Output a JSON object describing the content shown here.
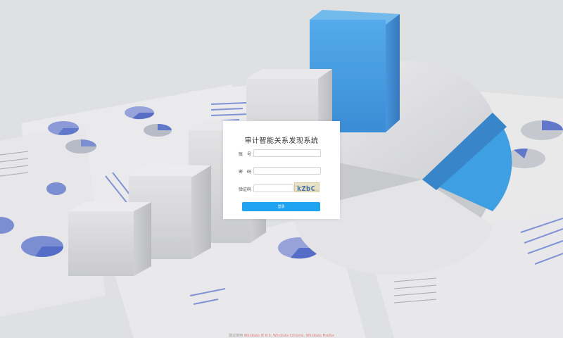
{
  "login": {
    "title": "审计智能关系发现系统",
    "account_label": "账　号",
    "account_value": "",
    "password_label": "密　码",
    "password_value": "",
    "captcha_label": "验证码",
    "captcha_value": "",
    "captcha_text": "kZbC",
    "login_button": "登录"
  },
  "footer": {
    "prefix": "建议使用",
    "browsers": [
      "Windows IE 8.0",
      "Windows Chrome",
      "Windows Firefox"
    ]
  },
  "colors": {
    "accent": "#1ea3f0",
    "cube_blue": "#2a8fe0",
    "pie_blue": "#1f95e6"
  }
}
